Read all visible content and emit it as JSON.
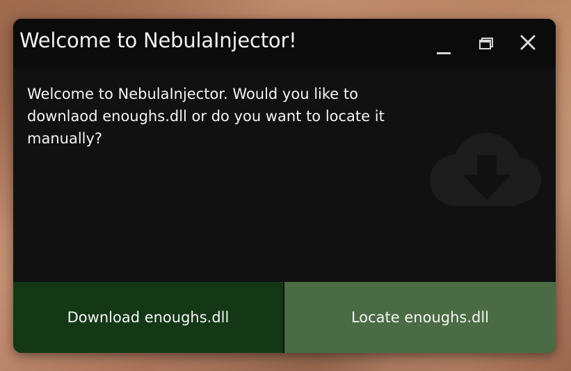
{
  "window": {
    "title": "Welcome to NebulaInjector!",
    "message": "Welcome to NebulaInjector. Would you like to downlaod enoughs.dll or do you want to locate it manually?"
  },
  "titlebar_buttons": {
    "minimize_icon": "minimize-icon",
    "maximize_icon": "restore-icon",
    "close_icon": "close-icon"
  },
  "actions": {
    "download_label": "Download enoughs.dll",
    "locate_label": "Locate enoughs.dll"
  },
  "watermark_icon": "cloud-download-icon",
  "colors": {
    "window_bg": "#111112",
    "titlebar_bg": "#0b0b0b",
    "download_button": "#143816",
    "locate_button": "#4a6b43",
    "text": "#f5f5f5"
  }
}
